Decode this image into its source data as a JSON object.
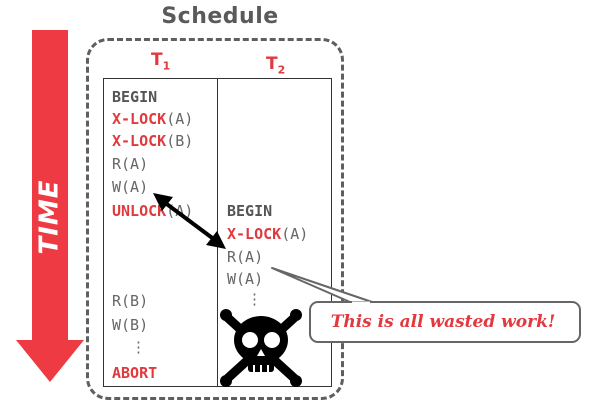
{
  "title": "Schedule",
  "time_label": "TIME",
  "columns": {
    "t1": {
      "name": "T",
      "sub": "1"
    },
    "t2": {
      "name": "T",
      "sub": "2"
    }
  },
  "t1_ops": {
    "begin": "BEGIN",
    "xlock_a_kw": "X-LOCK",
    "xlock_a_arg": "(A)",
    "xlock_b_kw": "X-LOCK",
    "xlock_b_arg": "(B)",
    "read_a": "R(A)",
    "write_a": "W(A)",
    "unlock_kw": "UNLOCK",
    "unlock_arg": "(A)",
    "read_b": "R(B)",
    "write_b": "W(B)",
    "ellipsis": "⋮",
    "abort": "ABORT"
  },
  "t2_ops": {
    "begin": "BEGIN",
    "xlock_a_kw": "X-LOCK",
    "xlock_a_arg": "(A)",
    "read_a": "R(A)",
    "write_a": "W(A)",
    "ellipsis": "⋮"
  },
  "callout": "This is all wasted work!",
  "icons": {
    "time_arrow": "down-arrow-icon",
    "dependency": "double-arrow-icon",
    "death": "skull-crossbones-icon"
  },
  "colors": {
    "accent_red": "#e2383f",
    "arrow_red": "#ee3a42",
    "frame_gray": "#5f5f5f",
    "text_gray": "#666666"
  }
}
